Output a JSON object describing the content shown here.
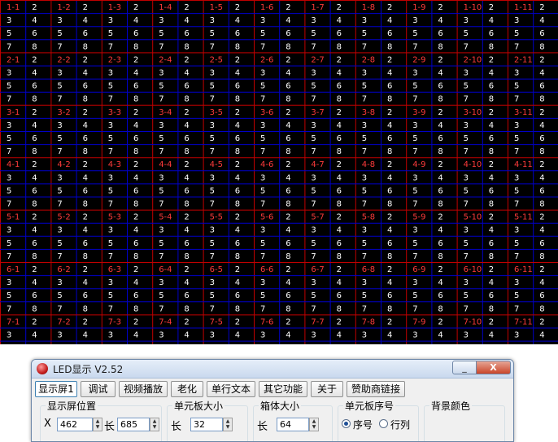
{
  "grid": {
    "block_labels_rows": [
      "1",
      "2",
      "3",
      "4",
      "5",
      "6",
      "7"
    ],
    "block_labels_cols": [
      "1",
      "2",
      "3",
      "4",
      "5",
      "6",
      "7",
      "8",
      "9",
      "10",
      "11"
    ],
    "label_separator": "-",
    "second_cell_text": "2",
    "row_values": [
      "3",
      "4",
      "5",
      "6",
      "7",
      "8"
    ],
    "colors": {
      "background": "#000000",
      "label_text": "#ff3b3b",
      "cell_text": "#ffffff",
      "grid_line": "#0000c8",
      "block_line": "#c00000"
    }
  },
  "window": {
    "title": "LED显示 V2.52",
    "minimize_label": "_",
    "close_label": "X"
  },
  "tabs": [
    "显示屏1",
    "调试",
    "视频播放",
    "老化",
    "单行文本",
    "其它功能",
    "关于",
    "赞助商链接"
  ],
  "active_tab": 0,
  "groups": {
    "position": {
      "title": "显示屏位置",
      "x_label": "X",
      "x_value": "462",
      "len_label": "长",
      "len_value": "685"
    },
    "unit_size": {
      "title": "单元板大小",
      "len_label": "长",
      "len_value": "32"
    },
    "box_size": {
      "title": "箱体大小",
      "len_label": "长",
      "len_value": "64"
    },
    "unit_seq": {
      "title": "单元板序号",
      "opt1": "序号",
      "opt2": "行列"
    },
    "bg_color": {
      "title": "背景颜色"
    }
  }
}
